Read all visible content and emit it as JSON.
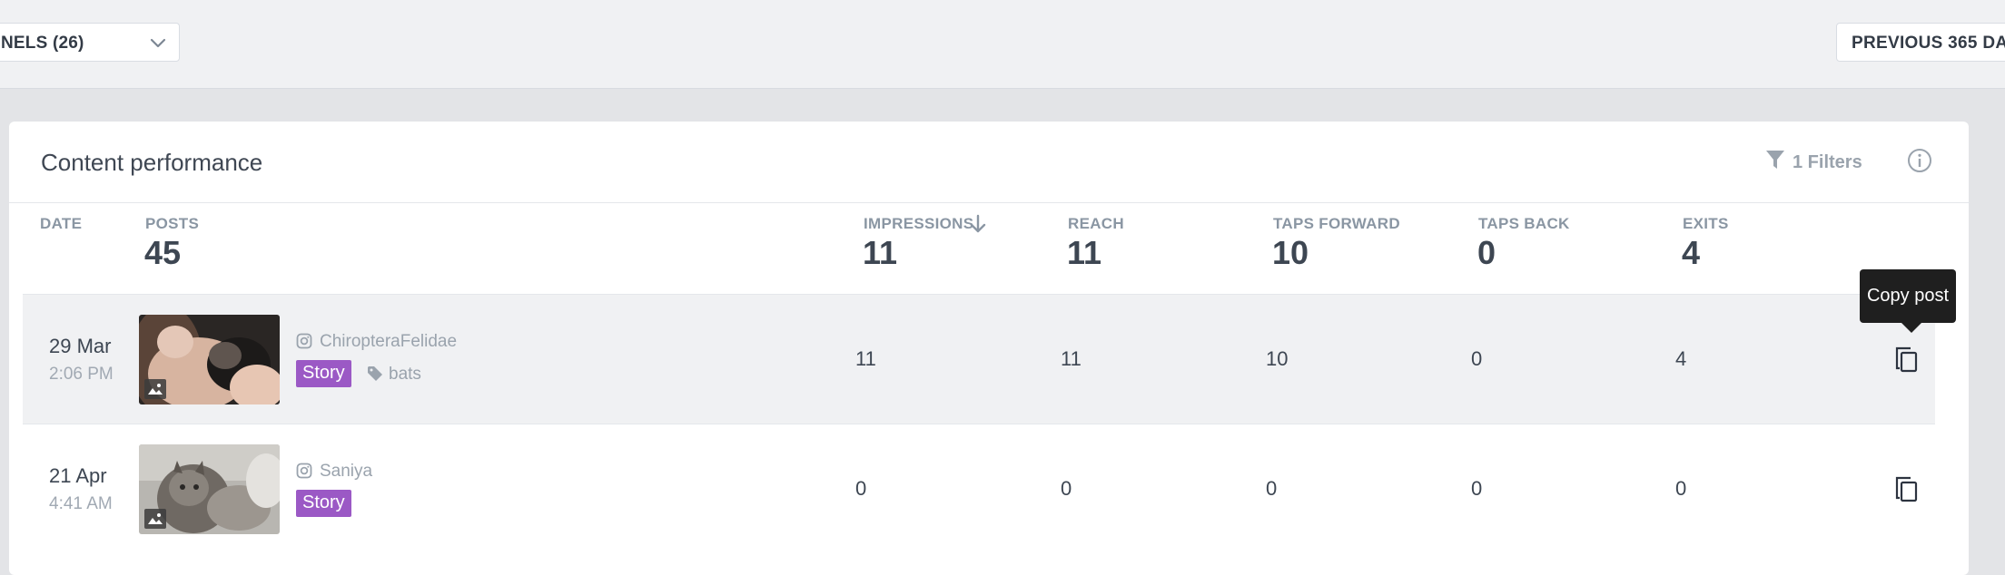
{
  "toolbar": {
    "channels_label": "NELS (26)",
    "date_range_label": "PREVIOUS 365 DA"
  },
  "card": {
    "title": "Content performance",
    "filters_label": "1 Filters"
  },
  "columns": {
    "date": "DATE",
    "posts": "POSTS",
    "impressions": "IMPRESSIONS",
    "reach": "REACH",
    "taps_forward": "TAPS FORWARD",
    "taps_back": "TAPS BACK",
    "exits": "EXITS"
  },
  "totals": {
    "posts": "45",
    "impressions": "11",
    "reach": "11",
    "taps_forward": "10",
    "taps_back": "0",
    "exits": "4"
  },
  "rows": [
    {
      "date": "29 Mar",
      "time": "2:06 PM",
      "account": "ChiropteraFelidae",
      "type": "Story",
      "tag": "bats",
      "impressions": "11",
      "reach": "11",
      "taps_forward": "10",
      "taps_back": "0",
      "exits": "4"
    },
    {
      "date": "21 Apr",
      "time": "4:41 AM",
      "account": "Saniya",
      "type": "Story",
      "impressions": "0",
      "reach": "0",
      "taps_forward": "0",
      "taps_back": "0",
      "exits": "0"
    }
  ],
  "tooltip": {
    "copy_post": "Copy post"
  },
  "icons": {
    "channels_dropdown": "chevron-down-icon",
    "filter": "filter-icon",
    "info": "info-icon",
    "sort": "arrow-down-icon",
    "platform": "instagram-icon",
    "tag": "tag-icon",
    "media": "image-icon",
    "copy": "copy-icon"
  },
  "colors": {
    "story_tag": "#9b59c5",
    "tooltip_bg": "#1f1f1f",
    "hover_row": "#f0f1f3"
  }
}
